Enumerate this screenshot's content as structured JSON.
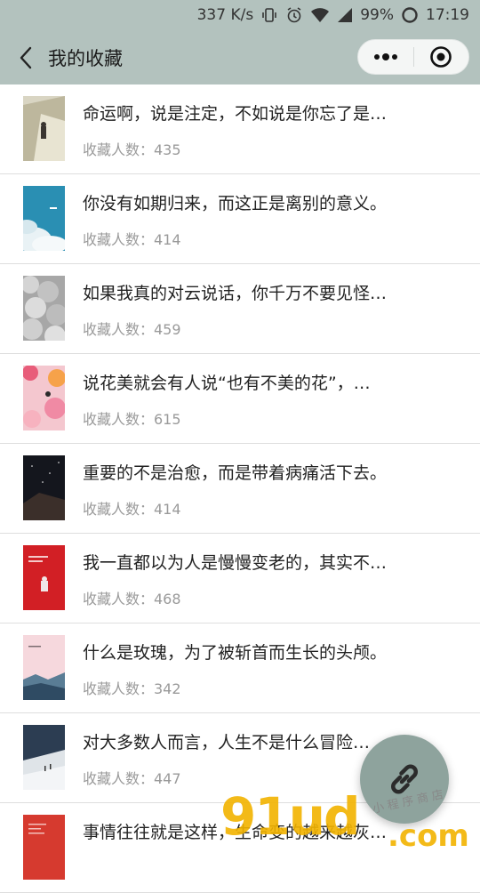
{
  "status_bar": {
    "speed": "337 K/s",
    "battery": "99%",
    "time": "17:19"
  },
  "nav": {
    "title": "我的收藏"
  },
  "items": [
    {
      "title": "命运啊，说是注定，不如说是你忘了是…",
      "meta": "收藏人数：435"
    },
    {
      "title": "你没有如期归来，而这正是离别的意义。",
      "meta": "收藏人数：414"
    },
    {
      "title": "如果我真的对云说话，你千万不要见怪…",
      "meta": "收藏人数：459"
    },
    {
      "title": "说花美就会有人说“也有不美的花”，…",
      "meta": "收藏人数：615"
    },
    {
      "title": "重要的不是治愈，而是带着病痛活下去。",
      "meta": "收藏人数：414"
    },
    {
      "title": "我一直都以为人是慢慢变老的，其实不…",
      "meta": "收藏人数：468"
    },
    {
      "title": "什么是玫瑰，为了被斩首而生长的头颅。",
      "meta": "收藏人数：342"
    },
    {
      "title": "对大多数人而言，人生不是什么冒险…",
      "meta": "收藏人数：447"
    },
    {
      "title": "事情往往就是这样，生命变的越来越灰…",
      "meta": ""
    }
  ],
  "fab": {
    "icon": "link-icon"
  },
  "watermark": {
    "brand": "91ud",
    "domain": ".com",
    "sub": "小程序商店"
  },
  "colors": {
    "header": "#b3c2be",
    "fab": "#8ea39d",
    "watermark": "#f2b300"
  }
}
